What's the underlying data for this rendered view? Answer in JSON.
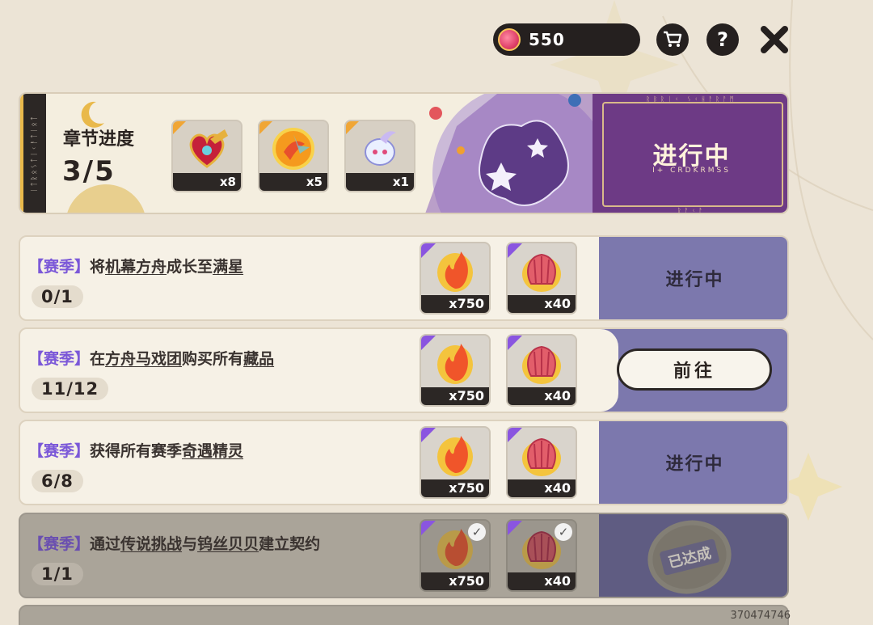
{
  "currency": {
    "icon": "gem-coin-icon",
    "amount": "550"
  },
  "header_buttons": {
    "cart_icon": "cart-icon",
    "help_label": "?",
    "close_label": "✖"
  },
  "chapter": {
    "title": "章节进度",
    "progress": "3/5",
    "side_runes": "ᛁᛏᚱᛟᛊᛏᛁᚲᚨᛏᛁᛟᛏ",
    "items": [
      {
        "icon": "heart-trumpet-icon",
        "qty": "x8"
      },
      {
        "icon": "orange-orb-icon",
        "qty": "x5"
      },
      {
        "icon": "spirit-wisp-icon",
        "qty": "x1"
      }
    ],
    "status": "进行中",
    "status_sub": "I+ CRDKRMSS",
    "runes_top": "ᚱᛒᚱᛁᚲ ᛊᚲᚺᚨᚱᚨᛗ",
    "runes_bottom": "ᚱᚨᚲᚨ"
  },
  "missions": [
    {
      "tag": "【赛季】",
      "text_parts": [
        "将",
        "机幕方舟",
        "成长至",
        "满星"
      ],
      "count": "0/1",
      "rewards": [
        {
          "icon": "flame-icon",
          "qty": "x750"
        },
        {
          "icon": "shell-icon",
          "qty": "x40"
        }
      ],
      "status": "进行中"
    },
    {
      "tag": "【赛季】",
      "text_parts": [
        "在",
        "方舟马戏团",
        "购买所有",
        "藏品"
      ],
      "count": "11/12",
      "rewards": [
        {
          "icon": "flame-icon",
          "qty": "x750"
        },
        {
          "icon": "shell-icon",
          "qty": "x40"
        }
      ],
      "button": "前往"
    },
    {
      "tag": "【赛季】",
      "text_parts": [
        "获得所有赛季",
        "奇遇精灵"
      ],
      "count": "6/8",
      "rewards": [
        {
          "icon": "flame-icon",
          "qty": "x750"
        },
        {
          "icon": "shell-icon",
          "qty": "x40"
        }
      ],
      "status": "进行中"
    },
    {
      "tag": "【赛季】",
      "text_parts": [
        "通过",
        "传说挑战",
        "与",
        "钨丝贝贝",
        "建立契约"
      ],
      "count": "1/1",
      "rewards": [
        {
          "icon": "flame-icon",
          "qty": "x750"
        },
        {
          "icon": "shell-icon",
          "qty": "x40"
        }
      ],
      "stamp": "已达成"
    }
  ],
  "footer_id": "370474746",
  "colors": {
    "accent_purple": "#7b58d8",
    "action_panel": "#7c78ad",
    "banner_panel": "#6d3a85"
  }
}
